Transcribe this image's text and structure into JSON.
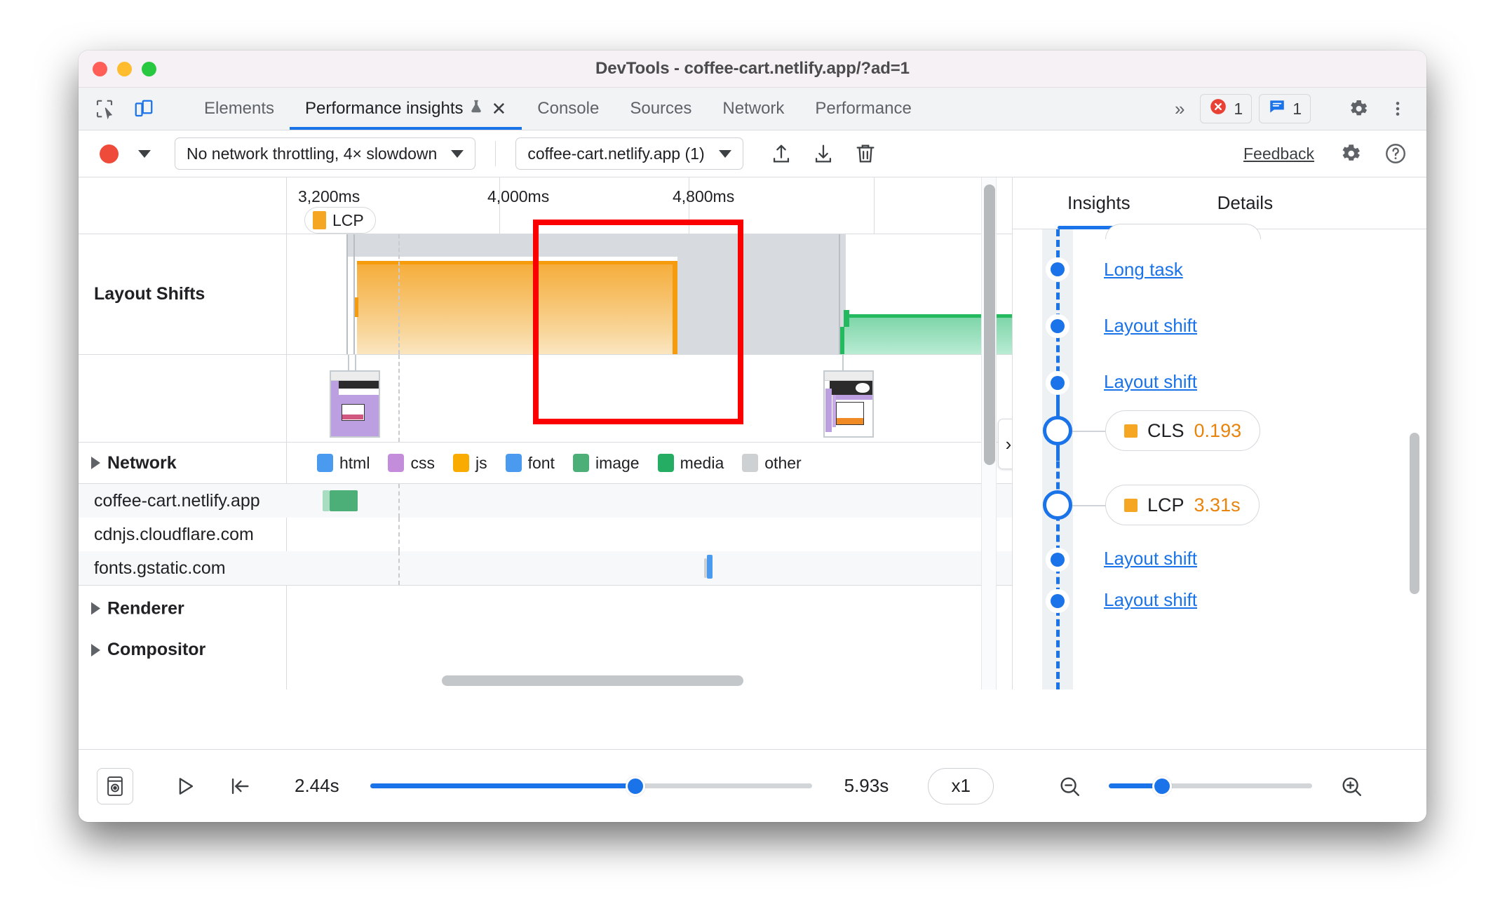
{
  "window": {
    "title": "DevTools - coffee-cart.netlify.app/?ad=1",
    "traffic": {
      "close": "close-window",
      "minimize": "minimize-window",
      "zoom": "zoom-window"
    }
  },
  "tabbar": {
    "inspect_icon": "inspect-element-icon",
    "device_icon": "device-toolbar-icon",
    "tabs": [
      {
        "label": "Elements",
        "active": false
      },
      {
        "label": "Performance insights",
        "active": true,
        "experimental_icon": "flask-icon",
        "close_icon": "close-icon"
      },
      {
        "label": "Console",
        "active": false
      },
      {
        "label": "Sources",
        "active": false
      },
      {
        "label": "Network",
        "active": false
      },
      {
        "label": "Performance",
        "active": false
      }
    ],
    "more_tabs_icon": "chevron-double-right-icon",
    "errors": {
      "icon": "error-icon",
      "count": "1"
    },
    "messages": {
      "icon": "message-icon",
      "count": "1"
    },
    "settings_icon": "gear-icon",
    "more_icon": "kebab-menu-icon"
  },
  "toolbar": {
    "record_icon": "record-circle-icon",
    "record_dropdown_icon": "triangle-down-icon",
    "throttling_value": "No network throttling, 4× slowdown",
    "throttling_caret": "triangle-down-icon",
    "page_value": "coffee-cart.netlify.app (1)",
    "page_caret": "triangle-down-icon",
    "upload_icon": "upload-icon",
    "download_icon": "download-icon",
    "delete_icon": "trash-icon",
    "feedback_label": "Feedback",
    "settings_icon": "gear-icon",
    "help_icon": "help-icon"
  },
  "timeline": {
    "ruler_ticks": [
      "3,200ms",
      "4,000ms",
      "4,800ms"
    ],
    "markers": [
      {
        "label": "LCP",
        "swatch_color": "#f5a623"
      }
    ],
    "tracks": [
      {
        "label": "Layout Shifts"
      }
    ],
    "filmstrip": [
      {
        "name": "screenshot-thumbnail-1"
      },
      {
        "name": "screenshot-thumbnail-2"
      }
    ],
    "annotation": {
      "name": "red-highlight-box",
      "color": "#fb0000"
    },
    "collapse_handle_icon": "chevron-right-icon"
  },
  "network": {
    "section_label": "Network",
    "expand_icon": "caret-right-icon",
    "legend": [
      {
        "label": "html",
        "color": "#4a9bf0"
      },
      {
        "label": "css",
        "color": "#c38ddc"
      },
      {
        "label": "js",
        "color": "#f9ab00"
      },
      {
        "label": "font",
        "color": "#4a9bf0"
      },
      {
        "label": "image",
        "color": "#4caf77"
      },
      {
        "label": "media",
        "color": "#25ae63"
      },
      {
        "label": "other",
        "color": "#cdd1d4"
      }
    ],
    "rows": [
      {
        "name": "coffee-cart.netlify.app",
        "bar_color": "#4caf77",
        "bar_left_pct": 5.2,
        "bar_width_pct": 5.3
      },
      {
        "name": "cdnjs.cloudflare.com",
        "bar_color": "",
        "bar_left_pct": 0,
        "bar_width_pct": 0
      },
      {
        "name": "fonts.gstatic.com",
        "bar_color": "#4a9bf0",
        "bar_left_pct": 76.8,
        "bar_width_pct": 0.7
      }
    ]
  },
  "other_sections": [
    {
      "label": "Renderer",
      "expand_icon": "caret-right-icon"
    },
    {
      "label": "Compositor",
      "expand_icon": "caret-right-icon"
    }
  ],
  "insights": {
    "tabs": [
      {
        "label": "Insights",
        "active": true
      },
      {
        "label": "Details",
        "active": false
      }
    ],
    "items": [
      {
        "type": "link",
        "label": "Long task"
      },
      {
        "type": "link",
        "label": "Layout shift"
      },
      {
        "type": "link",
        "label": "Layout shift"
      },
      {
        "type": "metric",
        "label": "CLS",
        "value": "0.193",
        "swatch_color": "#f5a623"
      },
      {
        "type": "metric",
        "label": "LCP",
        "value": "3.31s",
        "swatch_color": "#f5a623"
      },
      {
        "type": "link",
        "label": "Layout shift"
      },
      {
        "type": "link",
        "label": "Layout shift"
      }
    ]
  },
  "bottombar": {
    "screenshot_icon": "screenshot-toggle-icon",
    "play_icon": "play-icon",
    "jump_start_icon": "jump-to-start-icon",
    "time_start": "2.44s",
    "time_end": "5.93s",
    "speed_label": "x1",
    "zoom_out_icon": "zoom-out-icon",
    "zoom_in_icon": "zoom-in-icon"
  }
}
